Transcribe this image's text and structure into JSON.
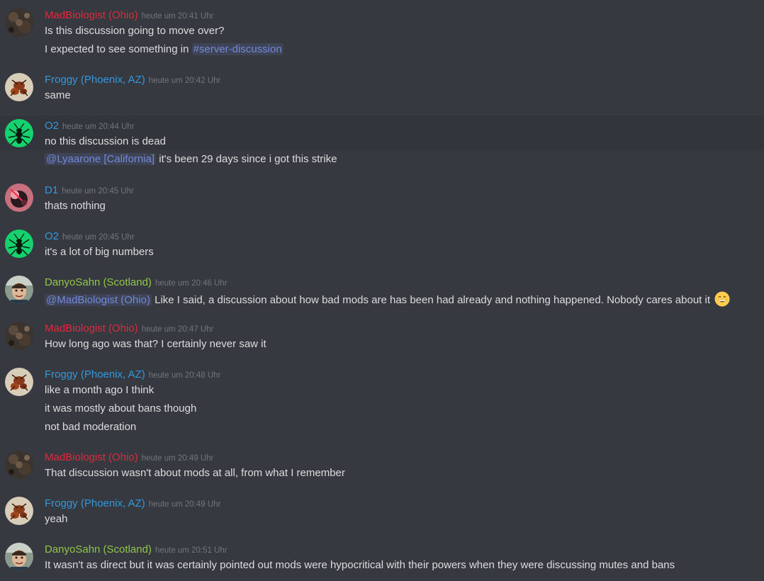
{
  "colors": {
    "background": "#36393f",
    "highlight_row": "#32353b",
    "text": "#dcddde",
    "timestamp": "#72767d",
    "mention": "#7289da",
    "user_red": "#e0283e",
    "user_blue": "#3498db",
    "user_green": "#91c748"
  },
  "messages": [
    {
      "username": "MadBiologist (Ohio)",
      "timestamp": "heute um 20:41 Uhr",
      "line1": "Is this discussion going to move over?",
      "line2_text": "I expected to see something in ",
      "line2_channel": "#server-discussion"
    },
    {
      "username": "Froggy (Phoenix, AZ)",
      "timestamp": "heute um 20:42 Uhr",
      "line1": "same"
    },
    {
      "username": "O2",
      "timestamp": "heute um 20:44 Uhr",
      "line1": "no this discussion is dead",
      "line2_mention": "@Lyaarone [California]",
      "line2_text": " it's been 29 days since i got this strike"
    },
    {
      "username": "D1",
      "timestamp": "heute um 20:45 Uhr",
      "line1": "thats nothing"
    },
    {
      "username": "O2",
      "timestamp": "heute um 20:45 Uhr",
      "line1": "it's a lot of big numbers"
    },
    {
      "username": "DanyoSahn (Scotland)",
      "timestamp": "heute um 20:46 Uhr",
      "line1_mention": "@MadBiologist (Ohio)",
      "line1_text": " Like I said, a discussion about how bad mods are has been had already and nothing happened. Nobody cares about it ",
      "line1_emoji": "grinning-face-emoji"
    },
    {
      "username": "MadBiologist (Ohio)",
      "timestamp": "heute um 20:47 Uhr",
      "line1": "How long ago was that? I certainly never saw it"
    },
    {
      "username": "Froggy (Phoenix, AZ)",
      "timestamp": "heute um 20:48 Uhr",
      "line1": "like a month ago I think",
      "line2": "it was mostly about bans though",
      "line3": "not bad moderation"
    },
    {
      "username": "MadBiologist (Ohio)",
      "timestamp": "heute um 20:49 Uhr",
      "line1": "That discussion wasn't about mods at all, from what I remember"
    },
    {
      "username": "Froggy (Phoenix, AZ)",
      "timestamp": "heute um 20:49 Uhr",
      "line1": "yeah"
    },
    {
      "username": "DanyoSahn (Scotland)",
      "timestamp": "heute um 20:51 Uhr",
      "line1": "It wasn't as direct but it was certainly pointed out mods were hypocritical with their powers when they were discussing mutes and bans"
    }
  ]
}
